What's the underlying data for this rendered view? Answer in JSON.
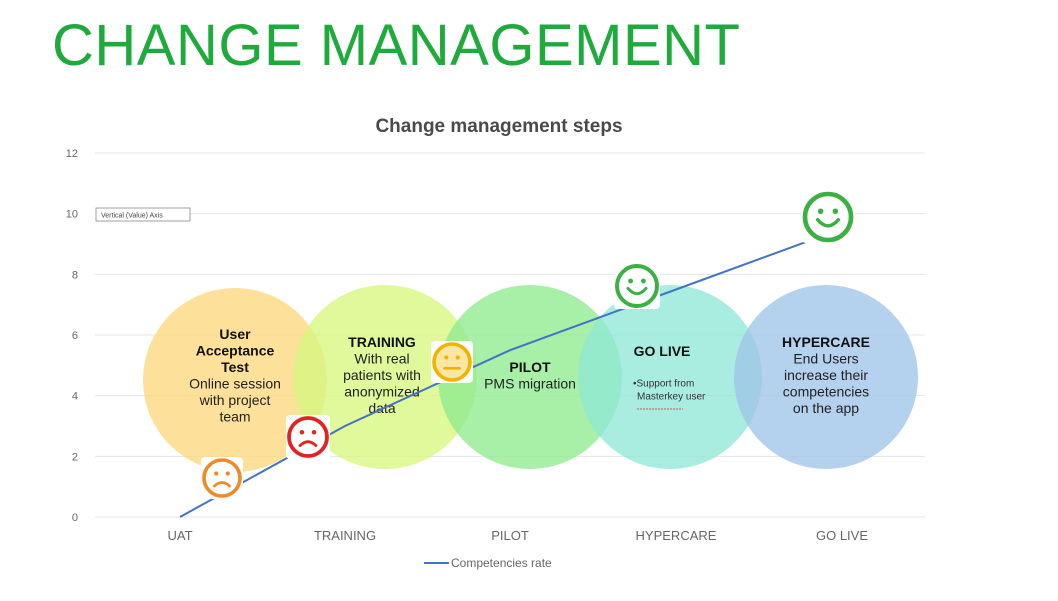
{
  "page": {
    "title": "CHANGE MANAGEMENT"
  },
  "chart_data": {
    "type": "line",
    "title": "Change management steps",
    "categories": [
      "UAT",
      "TRAINING",
      "PILOT",
      "HYPERCARE",
      "GO LIVE"
    ],
    "series": [
      {
        "name": "Competencies rate",
        "values": [
          0,
          3,
          5.5,
          7.5,
          9.5
        ],
        "color": "#4472c4"
      }
    ],
    "y_ticks": [
      0,
      2,
      4,
      6,
      8,
      10,
      12
    ],
    "ylim": [
      0,
      12
    ],
    "grid": true,
    "legend": "bottom",
    "axis_tooltip": "Vertical (Value) Axis",
    "steps": [
      {
        "title": "User Acceptance Test",
        "title_lines": [
          "User",
          "Acceptance",
          "Test"
        ],
        "body_lines": [
          "Online session",
          "with project",
          "team"
        ],
        "color": "#fdd77c"
      },
      {
        "title": "TRAINING",
        "title_lines": [
          "TRAINING"
        ],
        "body_lines": [
          "With real",
          "patients with",
          "anonymized",
          "data"
        ],
        "color": "#d6f77f"
      },
      {
        "title": "PILOT",
        "title_lines": [
          "PILOT"
        ],
        "body_lines": [
          "PMS migration"
        ],
        "color": "#8feb8f"
      },
      {
        "title": "GO LIVE",
        "title_lines": [
          "GO LIVE"
        ],
        "body_lines": [
          "•Support from",
          "Masterkey user"
        ],
        "color": "#8fe8d6"
      },
      {
        "title": "HYPERCARE",
        "title_lines": [
          "HYPERCARE"
        ],
        "body_lines": [
          "End Users",
          "increase their",
          "competencies",
          "on the app"
        ],
        "color": "#9fc4e8"
      }
    ],
    "markers": [
      {
        "mood": "sad",
        "color": "#f08a24",
        "icon": "sad-face-icon"
      },
      {
        "mood": "sad",
        "color": "#e02424",
        "icon": "sad-face-icon"
      },
      {
        "mood": "neutral",
        "color": "#f0b400",
        "icon": "neutral-face-icon"
      },
      {
        "mood": "happy",
        "color": "#3cb043",
        "icon": "happy-face-icon"
      },
      {
        "mood": "happy",
        "color": "#3cb043",
        "icon": "happy-face-icon"
      }
    ]
  }
}
